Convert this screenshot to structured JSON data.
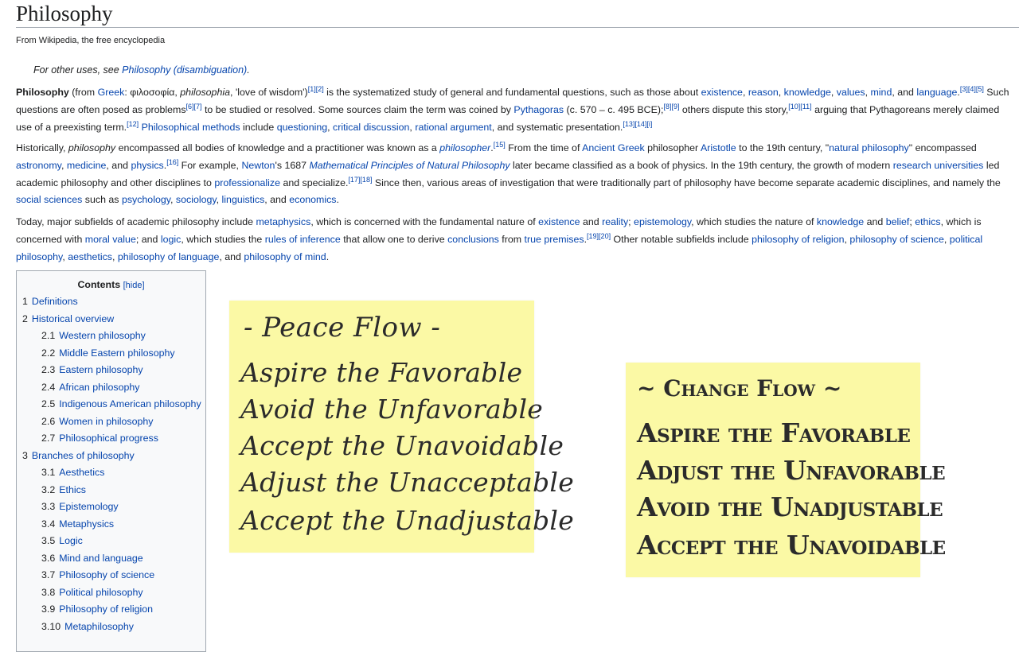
{
  "title": "Philosophy",
  "tagline": "From Wikipedia, the free encyclopedia",
  "hatnote": {
    "prefix": "For other uses, see ",
    "link": "Philosophy (disambiguation)",
    "suffix": "."
  },
  "p1": {
    "b": "Philosophy",
    "t1": " (from ",
    "l_greek": "Greek",
    "t2": ": φιλοσοφία, ",
    "i_philosophia": "philosophia",
    "t3": ", 'love of wisdom')",
    "r1": "[1][2]",
    "t4": " is the systematized study of general and fundamental questions, such as those about ",
    "l_existence": "existence",
    "c1": ", ",
    "l_reason": "reason",
    "c2": ", ",
    "l_knowledge": "knowledge",
    "c3": ", ",
    "l_values": "values",
    "c4": ", ",
    "l_mind": "mind",
    "t5": ", and ",
    "l_language": "language",
    "t6": ".",
    "r2": "[3][4][5]",
    "t7": " Such questions are often posed as problems",
    "r3": "[6][7]",
    "t8": " to be studied or resolved. Some sources claim the term was coined by ",
    "l_pythagoras": "Pythagoras",
    "t9": " (c. 570 – c. 495 BCE);",
    "r4": "[8][9]",
    "t10": " others dispute this story,",
    "r5": "[10][11]",
    "t11": " arguing that Pythagoreans merely claimed use of a preexisting term.",
    "r6": "[12]",
    "t12": " ",
    "l_methods": "Philosophical methods",
    "t13": " include ",
    "l_questioning": "questioning",
    "c5": ", ",
    "l_critical": "critical discussion",
    "c6": ", ",
    "l_rational": "rational argument",
    "t14": ", and systematic presentation.",
    "r7": "[13][14][i]"
  },
  "p2": {
    "t1": "Historically, ",
    "i1": "philosophy",
    "t2": " encompassed all bodies of knowledge and a practitioner was known as a ",
    "l_philosopher": "philosopher",
    "t3": ".",
    "r1": "[15]",
    "t4": " From the time of ",
    "l_ancient_greek": "Ancient Greek",
    "t5": " philosopher ",
    "l_aristotle": "Aristotle",
    "t6": " to the 19th century, \"",
    "l_natural": "natural philosophy",
    "t7": "\" encompassed ",
    "l_astronomy": "astronomy",
    "c1": ", ",
    "l_medicine": "medicine",
    "t8": ", and ",
    "l_physics": "physics",
    "t9": ".",
    "r2": "[16]",
    "t10": " For example, ",
    "l_newton": "Newton",
    "t11": "'s 1687 ",
    "l_principia": "Mathematical Principles of Natural Philosophy",
    "t12": " later became classified as a book of physics. In the 19th century, the growth of modern ",
    "l_research": "research universities",
    "t13": " led academic philosophy and other disciplines to ",
    "l_professionalize": "professionalize",
    "t14": " and specialize.",
    "r3": "[17][18]",
    "t15": " Since then, various areas of investigation that were traditionally part of philosophy have become separate academic disciplines, and namely the ",
    "l_social": "social sciences",
    "t16": " such as ",
    "l_psychology": "psychology",
    "c2": ", ",
    "l_sociology": "sociology",
    "c3": ", ",
    "l_linguistics": "linguistics",
    "t17": ", and ",
    "l_economics": "economics",
    "t18": "."
  },
  "p3": {
    "t1": "Today, major subfields of academic philosophy include ",
    "l_metaphysics": "metaphysics",
    "t2": ", which is concerned with the fundamental nature of ",
    "l_existence": "existence",
    "t3": " and ",
    "l_reality": "reality",
    "t4": "; ",
    "l_epistemology": "epistemology",
    "t5": ", which studies the nature of ",
    "l_knowledge": "knowledge",
    "t6": " and ",
    "l_belief": "belief",
    "t7": "; ",
    "l_ethics": "ethics",
    "t8": ", which is concerned with ",
    "l_moral": "moral value",
    "t9": "; and ",
    "l_logic": "logic",
    "t10": ", which studies the ",
    "l_rules": "rules of inference",
    "t11": " that allow one to derive ",
    "l_conclusions": "conclusions",
    "t12": " from ",
    "l_premises": "true premises",
    "t13": ".",
    "r1": "[19][20]",
    "t14": " Other notable subfields include ",
    "l_religion": "philosophy of religion",
    "c1": ", ",
    "l_science": "philosophy of science",
    "c2": ", ",
    "l_political": "political philosophy",
    "c3": ", ",
    "l_aesthetics": "aesthetics",
    "c4": ", ",
    "l_language": "philosophy of language",
    "t15": ", and ",
    "l_mind": "philosophy of mind",
    "t16": "."
  },
  "toc": {
    "title": "Contents",
    "hide": "[hide]",
    "items": [
      {
        "num": "1",
        "label": "Definitions"
      },
      {
        "num": "2",
        "label": "Historical overview"
      },
      {
        "num": "2.1",
        "label": "Western philosophy"
      },
      {
        "num": "2.2",
        "label": "Middle Eastern philosophy"
      },
      {
        "num": "2.3",
        "label": "Eastern philosophy"
      },
      {
        "num": "2.4",
        "label": "African philosophy"
      },
      {
        "num": "2.5",
        "label": "Indigenous American philosophy"
      },
      {
        "num": "2.6",
        "label": "Women in philosophy"
      },
      {
        "num": "2.7",
        "label": "Philosophical progress"
      },
      {
        "num": "3",
        "label": "Branches of philosophy"
      },
      {
        "num": "3.1",
        "label": "Aesthetics"
      },
      {
        "num": "3.2",
        "label": "Ethics"
      },
      {
        "num": "3.3",
        "label": "Epistemology"
      },
      {
        "num": "3.4",
        "label": "Metaphysics"
      },
      {
        "num": "3.5",
        "label": "Logic"
      },
      {
        "num": "3.6",
        "label": "Mind and language"
      },
      {
        "num": "3.7",
        "label": "Philosophy of science"
      },
      {
        "num": "3.8",
        "label": "Political philosophy"
      },
      {
        "num": "3.9",
        "label": "Philosophy of religion"
      },
      {
        "num": "3.10",
        "label": "Metaphilosophy"
      }
    ]
  },
  "note_peace": {
    "title": "- Peace Flow -",
    "lines": [
      "Aspire the Favorable",
      "Avoid the Unfavorable",
      "Accept the Unavoidable",
      "Adjust the Unacceptable",
      "Accept the Unadjustable"
    ]
  },
  "note_change": {
    "title": "~ Change Flow ~",
    "lines": [
      "Aspire the Favorable",
      "Adjust the Unfavorable",
      "Avoid the Unadjustable",
      "Accept the Unavoidable"
    ]
  },
  "colors": {
    "link": "#0645ad",
    "note": "#fbf9a5",
    "toc_bg": "#f8f9fa",
    "text": "#202122"
  }
}
